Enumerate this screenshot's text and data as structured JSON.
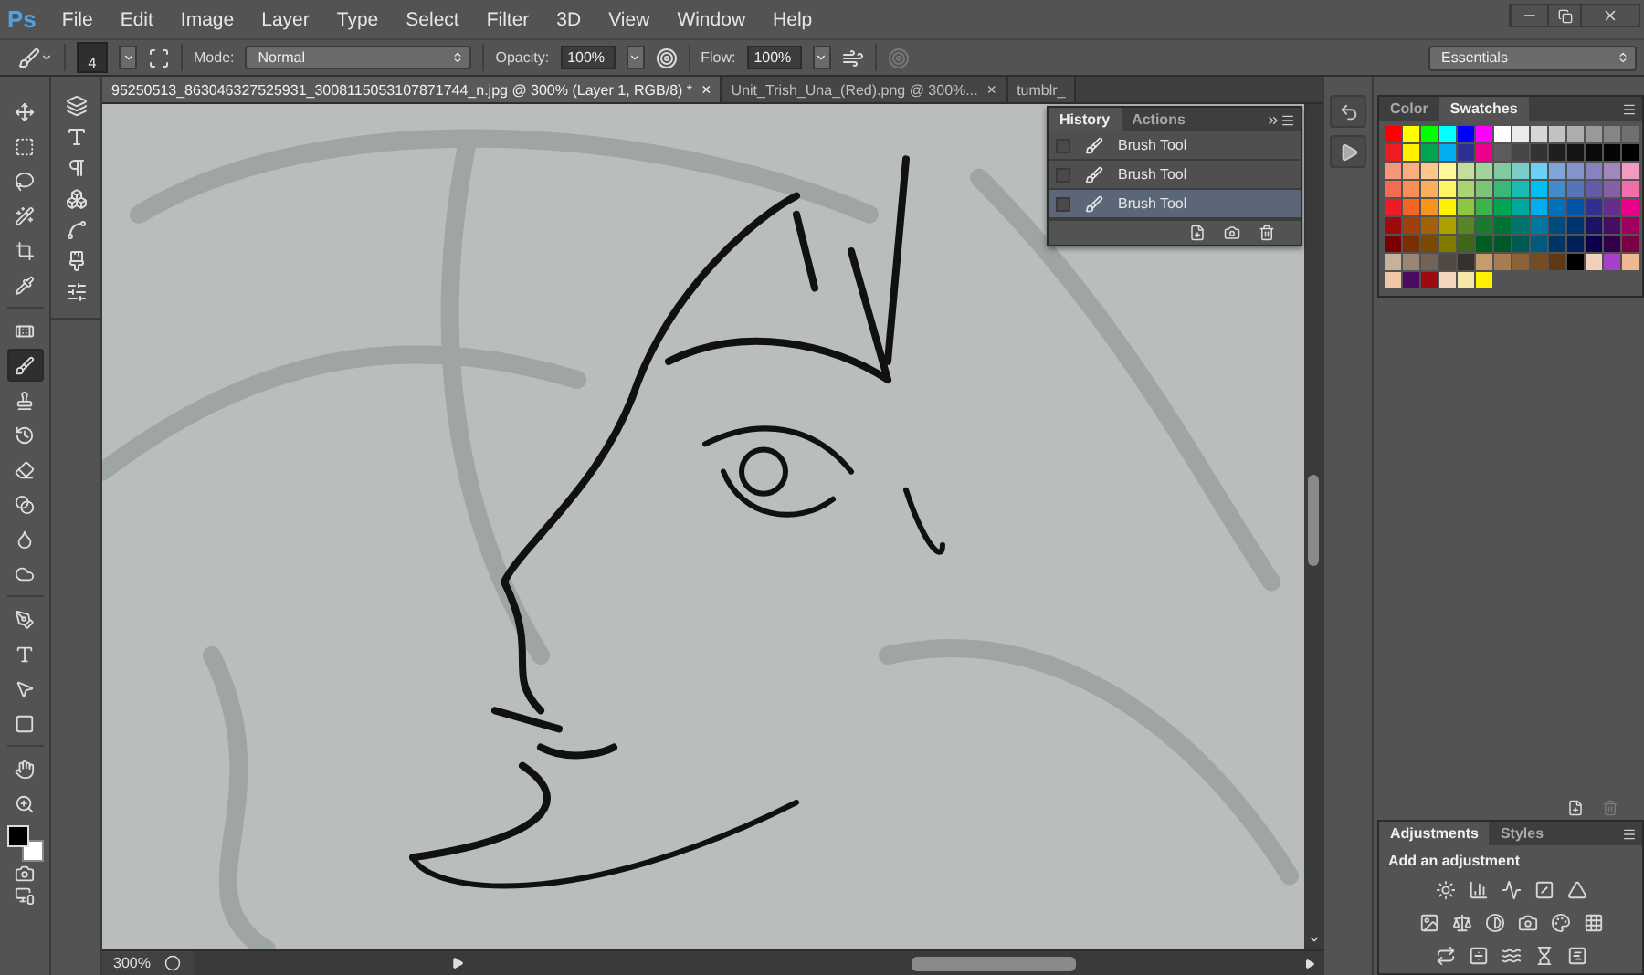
{
  "app": {
    "logo": "Ps"
  },
  "menu": [
    "File",
    "Edit",
    "Image",
    "Layer",
    "Type",
    "Select",
    "Filter",
    "3D",
    "View",
    "Window",
    "Help"
  ],
  "workspace": "Essentials",
  "options_bar": {
    "brush_size": "4",
    "mode_label": "Mode:",
    "mode": "Normal",
    "opacity_label": "Opacity:",
    "opacity": "100%",
    "flow_label": "Flow:",
    "flow": "100%"
  },
  "document_tabs": [
    {
      "label": "95250513_863046327525931_3008115053107871744_n.jpg @ 300% (Layer 1, RGB/8) *",
      "close": "×",
      "selected": true
    },
    {
      "label": "Unit_Trish_Una_(Red).png @ 300%...",
      "close": "×",
      "selected": false
    },
    {
      "label": "tumblr_",
      "selected": false
    }
  ],
  "tools": [
    {
      "selected": false
    },
    {
      "selected": false
    },
    {
      "selected": false
    },
    {
      "selected": false
    },
    {
      "selected": false
    },
    {
      "selected": false
    },
    {
      "selected": false
    },
    {
      "selected": true
    },
    {
      "selected": false
    },
    {
      "selected": false
    },
    {
      "selected": false
    },
    {
      "selected": false
    },
    {
      "selected": false
    },
    {
      "selected": false
    },
    {
      "selected": false
    },
    {
      "selected": false
    },
    {
      "selected": false
    },
    {
      "selected": false
    },
    {
      "selected": false
    },
    {
      "selected": false
    }
  ],
  "history_panel": {
    "tabs": [
      {
        "label": "History",
        "selected": true
      },
      {
        "label": "Actions",
        "selected": false
      }
    ],
    "items": [
      {
        "label": "Brush Tool",
        "selected": false
      },
      {
        "label": "Brush Tool",
        "selected": false
      },
      {
        "label": "Brush Tool",
        "selected": true
      }
    ]
  },
  "swatches_panel": {
    "tabs": [
      {
        "label": "Color",
        "selected": false
      },
      {
        "label": "Swatches",
        "selected": true
      }
    ],
    "rows": [
      {
        "swatches": [
          {
            "color": "#ff0000"
          },
          {
            "color": "#ffff00"
          },
          {
            "color": "#00ff00"
          },
          {
            "color": "#00ffff"
          },
          {
            "color": "#0000ff"
          },
          {
            "color": "#ff00ff"
          },
          {
            "color": "#ffffff"
          },
          {
            "color": "#ebebeb"
          },
          {
            "color": "#d6d6d6"
          },
          {
            "color": "#c2c2c2"
          },
          {
            "color": "#adadad"
          },
          {
            "color": "#999999"
          },
          {
            "color": "#858585"
          },
          {
            "color": "#707070"
          }
        ]
      },
      {
        "swatches": [
          {
            "color": "#ee1d24"
          },
          {
            "color": "#fff100"
          },
          {
            "color": "#00a650"
          },
          {
            "color": "#00aeef"
          },
          {
            "color": "#2e3192"
          },
          {
            "color": "#ec008c"
          },
          {
            "color": "#5c5c5c"
          },
          {
            "color": "#474747"
          },
          {
            "color": "#333333"
          },
          {
            "color": "#1f1f1f"
          },
          {
            "color": "#141414"
          },
          {
            "color": "#0a0a0a"
          },
          {
            "color": "#050505"
          },
          {
            "color": "#000000"
          }
        ]
      },
      {
        "swatches": [
          {
            "color": "#f7977a"
          },
          {
            "color": "#f9ad81"
          },
          {
            "color": "#fdc68a"
          },
          {
            "color": "#fff79a"
          },
          {
            "color": "#c4df9b"
          },
          {
            "color": "#a2d39c"
          },
          {
            "color": "#82ca9d"
          },
          {
            "color": "#7bcdc8"
          },
          {
            "color": "#6ecff6"
          },
          {
            "color": "#7ea7d8"
          },
          {
            "color": "#8493ca"
          },
          {
            "color": "#8882be"
          },
          {
            "color": "#a187be"
          },
          {
            "color": "#f49ac2"
          }
        ]
      },
      {
        "swatches": [
          {
            "color": "#f26c4f"
          },
          {
            "color": "#f68e55"
          },
          {
            "color": "#fbaf5c"
          },
          {
            "color": "#fff467"
          },
          {
            "color": "#acd372"
          },
          {
            "color": "#7cc576"
          },
          {
            "color": "#3bb878"
          },
          {
            "color": "#1abbb4"
          },
          {
            "color": "#00bff3"
          },
          {
            "color": "#438ccb"
          },
          {
            "color": "#5574b9"
          },
          {
            "color": "#605ca8"
          },
          {
            "color": "#855fa8"
          },
          {
            "color": "#f06ea9"
          }
        ]
      },
      {
        "swatches": [
          {
            "color": "#ed1c24"
          },
          {
            "color": "#f26522"
          },
          {
            "color": "#f7941d"
          },
          {
            "color": "#fff200"
          },
          {
            "color": "#8dc73f"
          },
          {
            "color": "#39b54a"
          },
          {
            "color": "#00a651"
          },
          {
            "color": "#00a99d"
          },
          {
            "color": "#00aeef"
          },
          {
            "color": "#0072bc"
          },
          {
            "color": "#0054a6"
          },
          {
            "color": "#2e3192"
          },
          {
            "color": "#662d91"
          },
          {
            "color": "#ec008c"
          }
        ]
      },
      {
        "swatches": [
          {
            "color": "#9e0b0f"
          },
          {
            "color": "#a0410d"
          },
          {
            "color": "#a3620a"
          },
          {
            "color": "#aba000"
          },
          {
            "color": "#598527"
          },
          {
            "color": "#1a7b30"
          },
          {
            "color": "#007236"
          },
          {
            "color": "#00746b"
          },
          {
            "color": "#0076a3"
          },
          {
            "color": "#004b80"
          },
          {
            "color": "#003471"
          },
          {
            "color": "#1b1464"
          },
          {
            "color": "#440e62"
          },
          {
            "color": "#9e005d"
          }
        ]
      },
      {
        "swatches": [
          {
            "color": "#790000"
          },
          {
            "color": "#7b2e00"
          },
          {
            "color": "#7d4900"
          },
          {
            "color": "#827b00"
          },
          {
            "color": "#406618"
          },
          {
            "color": "#005e20"
          },
          {
            "color": "#005826"
          },
          {
            "color": "#005952"
          },
          {
            "color": "#005b7f"
          },
          {
            "color": "#003663"
          },
          {
            "color": "#002157"
          },
          {
            "color": "#0d004c"
          },
          {
            "color": "#32004b"
          },
          {
            "color": "#7b0046"
          }
        ]
      },
      {
        "swatches": [
          {
            "color": "#c7b299"
          },
          {
            "color": "#998675"
          },
          {
            "color": "#736357"
          },
          {
            "color": "#534741"
          },
          {
            "color": "#37302d"
          },
          {
            "color": "#c69c6d"
          },
          {
            "color": "#a67c52"
          },
          {
            "color": "#8c6239"
          },
          {
            "color": "#754c24"
          },
          {
            "color": "#603913"
          },
          {
            "color": "#000000"
          },
          {
            "color": "#f5d0b8"
          },
          {
            "color": "#a640c8"
          },
          {
            "color": "#f0b890"
          }
        ]
      },
      {
        "swatches": [
          {
            "color": "#f0c8a8"
          },
          {
            "color": "#4a0c5e"
          },
          {
            "color": "#9e0b0f"
          },
          {
            "color": "#f5d5c0"
          },
          {
            "color": "#f5e6a8"
          },
          {
            "color": "#fff200"
          }
        ]
      }
    ]
  },
  "adjustments_panel": {
    "tabs": [
      {
        "label": "Adjustments",
        "selected": true
      },
      {
        "label": "Styles",
        "selected": false
      }
    ],
    "heading": "Add an adjustment"
  },
  "status_bar": {
    "zoom": "300%"
  }
}
